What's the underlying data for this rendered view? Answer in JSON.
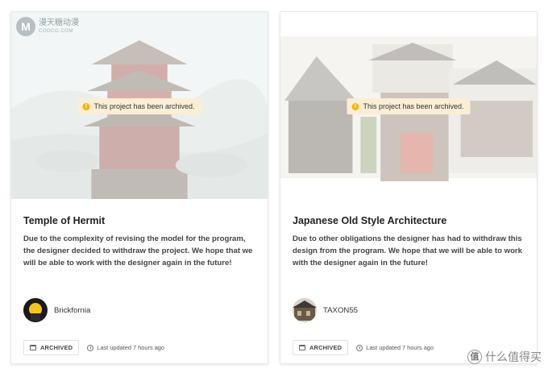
{
  "watermark": {
    "logo_letter": "M",
    "name": "漫天糖动漫",
    "site": "COOCG.COM"
  },
  "watermark_bottom": {
    "badge": "值",
    "text": "什么值得买"
  },
  "cards": [
    {
      "archived_notice": "This project has been archived.",
      "title": "Temple of Hermit",
      "description": "Due to the complexity of revising the model for the program, the designer decided to withdraw the project. We hope that we will be able to work with the designer again in the future!",
      "author": "Brickfornia",
      "status_badge": "ARCHIVED",
      "last_updated": "Last updated 7 hours ago"
    },
    {
      "archived_notice": "This project has been archived.",
      "title": "Japanese Old Style Architecture",
      "description": "Due to other obligations the designer has had to withdraw this design from the program. We hope that we will be able to work with the designer again in the future!",
      "author": "TAXON55",
      "status_badge": "ARCHIVED",
      "last_updated": "Last updated 7 hours ago"
    }
  ],
  "icons": {
    "warning": "warning-icon",
    "archive": "archive-box-icon",
    "clock": "clock-history-icon"
  }
}
